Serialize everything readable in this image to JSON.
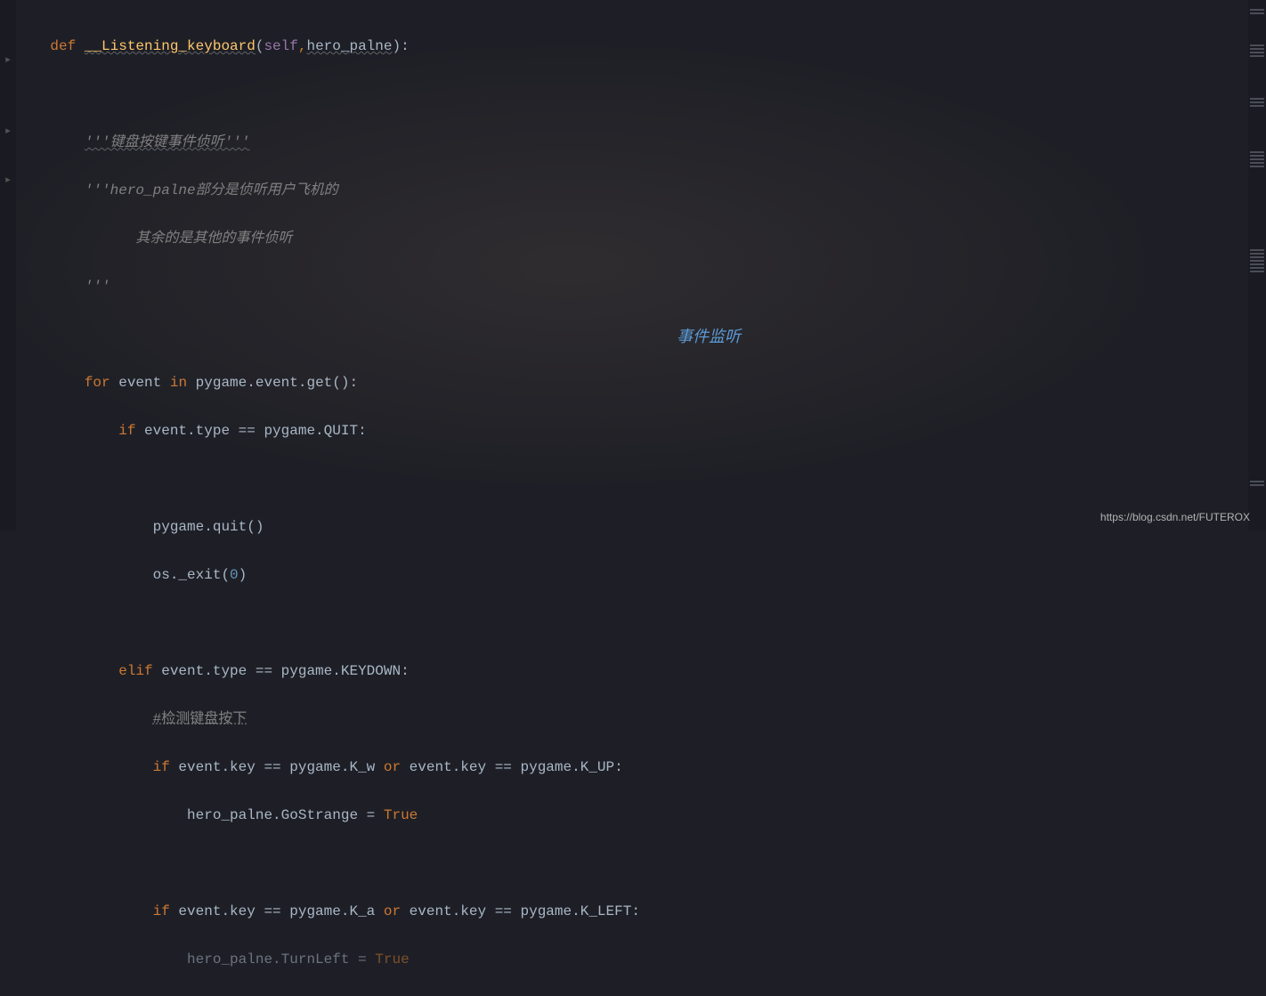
{
  "code": {
    "line1a": "def ",
    "line1b": "__Listening_keyboard",
    "line1c": "(",
    "line1d": "self",
    "line1e": ",",
    "line1f": "hero_palne",
    "line1g": "):",
    "line3a": "'''键盘按键事件侦听'''",
    "line4a": "'''hero_palne部分是侦听用户飞机的",
    "line5a": "      其余的是其他的事件侦听",
    "line6a": "'''",
    "line8a": "for",
    "line8b": " event ",
    "line8c": "in",
    "line8d": " pygame.event.get():",
    "line9a": "if",
    "line9b": " event.type == pygame.QUIT:",
    "line11a": "pygame.quit()",
    "line12a": "os._exit(",
    "line12b": "0",
    "line12c": ")",
    "line14a": "elif",
    "line14b": " event.type == pygame.KEYDOWN:",
    "line15a": "#检测键盘按下",
    "line16a": "if",
    "line16b": " event.key == pygame.K_w ",
    "line16c": "or",
    "line16d": " event.key == pygame.K_UP:",
    "line17a": "hero_palne.GoStrange = ",
    "line17b": "True",
    "line19a": "if",
    "line19b": " event.key == pygame.K_a ",
    "line19c": "or",
    "line19d": " event.key == pygame.K_LEFT:",
    "line20a": "hero_palne.TurnLeft = ",
    "line20b": "True"
  },
  "annotation": "事件监听",
  "watermark": "https://blog.csdn.net/FUTEROX"
}
